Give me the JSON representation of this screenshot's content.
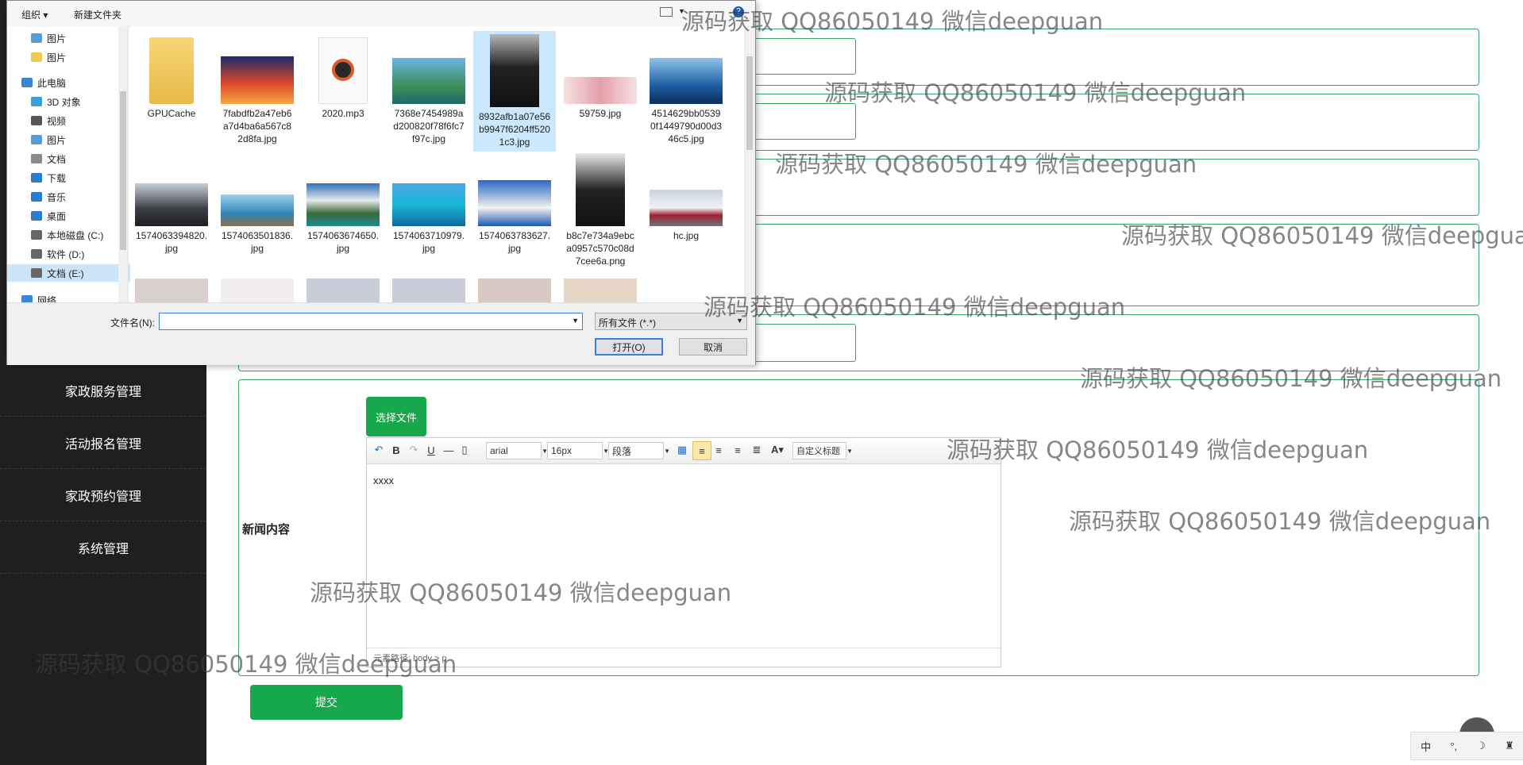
{
  "sidebar": {
    "items": [
      "家政服务管理",
      "活动报名管理",
      "家政预约管理",
      "系统管理"
    ]
  },
  "form": {
    "content_label": "新闻内容",
    "choose_file_label": "选择文件",
    "submit_label": "提交"
  },
  "editor": {
    "font_family": "arial",
    "font_size": "16px",
    "paragraph": "段落",
    "custom_title": "自定义标题",
    "body_text": "xxxx",
    "status_text": "元素路径: body > p"
  },
  "watermark": "源码获取 QQ86050149 微信deepguan",
  "dialog": {
    "toolbar": {
      "organize": "组织 ▾",
      "new_folder": "新建文件夹"
    },
    "nav": [
      {
        "label": "图片",
        "pinned": true,
        "color": "#5b9bd5"
      },
      {
        "label": "图片",
        "pinned": true,
        "color": "#f2c94c"
      },
      {
        "label": "此电脑",
        "pinned": false,
        "color": "#3a86d6"
      },
      {
        "label": "3D 对象",
        "pinned": false,
        "color": "#3aa3d6"
      },
      {
        "label": "视频",
        "pinned": false,
        "color": "#555"
      },
      {
        "label": "图片",
        "pinned": false,
        "color": "#5b9bd5"
      },
      {
        "label": "文档",
        "pinned": false,
        "color": "#8a8a8a"
      },
      {
        "label": "下载",
        "pinned": false,
        "color": "#2a7bd5"
      },
      {
        "label": "音乐",
        "pinned": false,
        "color": "#2a7bd5"
      },
      {
        "label": "桌面",
        "pinned": false,
        "color": "#2a7bd5"
      },
      {
        "label": "本地磁盘 (C:)",
        "pinned": false,
        "color": "#666"
      },
      {
        "label": "软件 (D:)",
        "pinned": false,
        "color": "#666"
      },
      {
        "label": "文档 (E:)",
        "pinned": false,
        "color": "#666"
      },
      {
        "label": "网络",
        "pinned": false,
        "color": "#3a86d6"
      }
    ],
    "files": [
      {
        "name": "GPUCache",
        "kind": "folder"
      },
      {
        "name": "7fabdfb2a47eb6a7d4ba6a567c82d8fa.jpg",
        "kind": "sunset"
      },
      {
        "name": "2020.mp3",
        "kind": "audio"
      },
      {
        "name": "7368e7454989ad200820f78f6fc7f97c.jpg",
        "kind": "lake"
      },
      {
        "name": "8932afb1a07e56b9947f6204ff5201c3.jpg",
        "kind": "man"
      },
      {
        "name": "59759.jpg",
        "kind": "pink"
      },
      {
        "name": "4514629bb05390f1449790d00d346c5.jpg",
        "kind": "blue"
      },
      {
        "name": "1574063394820.jpg",
        "kind": "mountain"
      },
      {
        "name": "1574063501836.jpg",
        "kind": "resort"
      },
      {
        "name": "1574063674650.jpg",
        "kind": "alps"
      },
      {
        "name": "1574063710979.jpg",
        "kind": "pier"
      },
      {
        "name": "1574063783627.jpg",
        "kind": "santorini"
      },
      {
        "name": "b8c7e734a9ebca0957c570c08d7cee6a.png",
        "kind": "woman"
      },
      {
        "name": "hc.jpg",
        "kind": "train"
      }
    ],
    "filename_label": "文件名(N):",
    "filename_value": "",
    "filetype": "所有文件 (*.*)",
    "open_label": "打开(O)",
    "cancel_label": "取消"
  },
  "ime": {
    "mode": "中"
  }
}
